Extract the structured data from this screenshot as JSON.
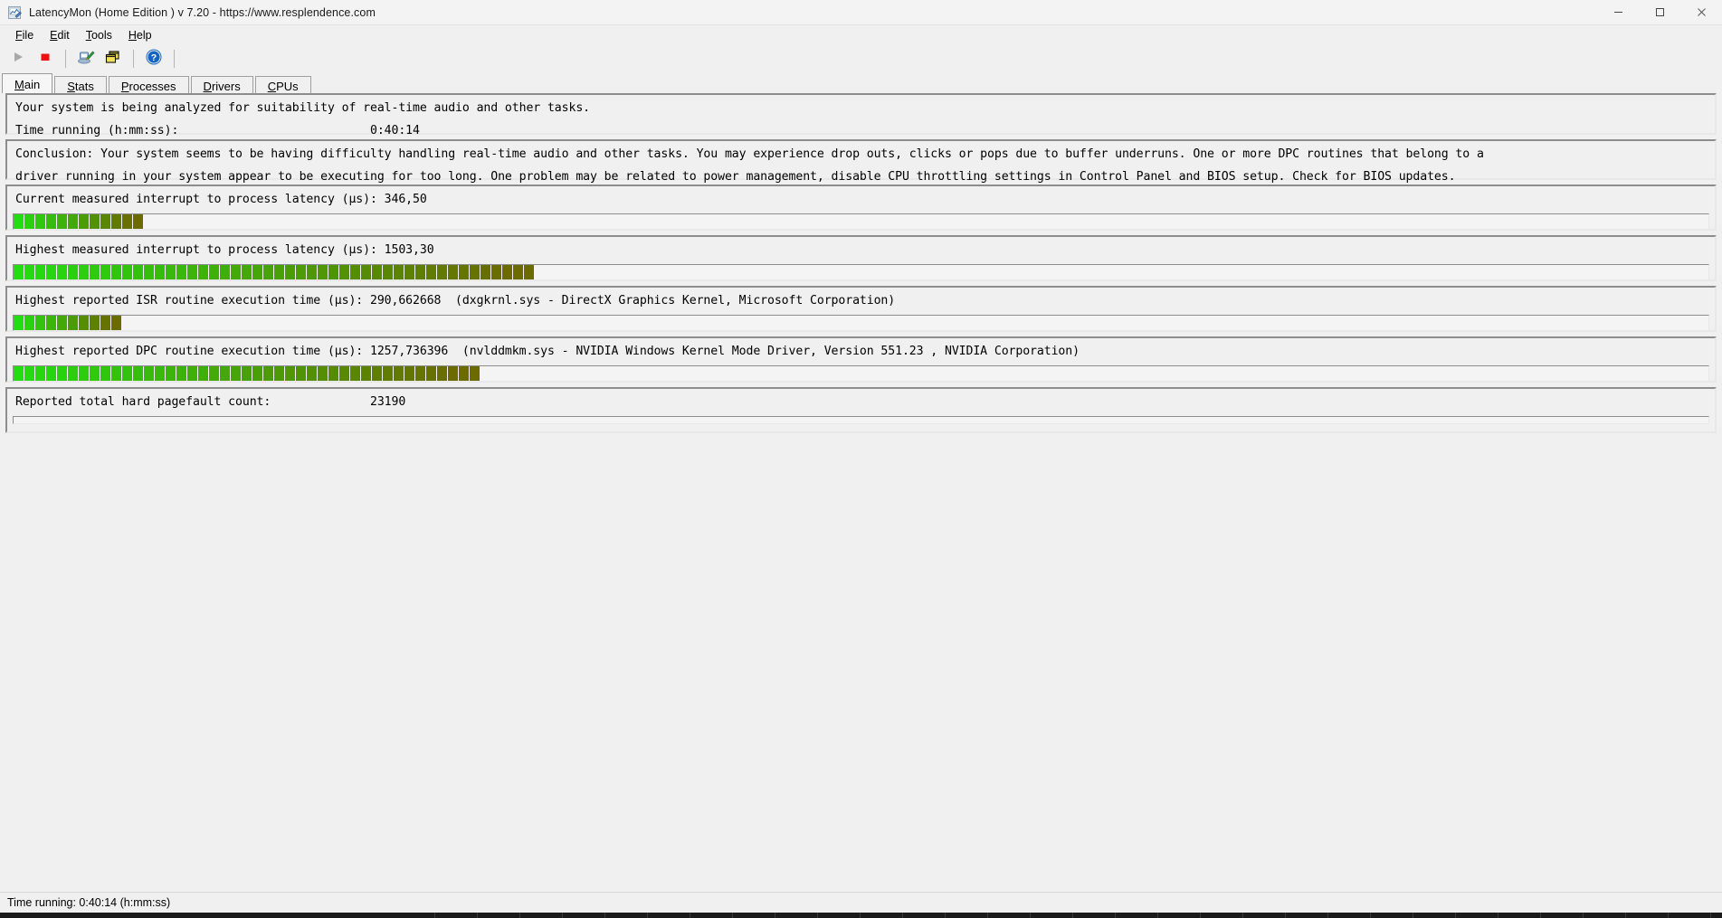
{
  "window": {
    "title": "LatencyMon  (Home Edition )  v 7.20 - https://www.resplendence.com",
    "app_icon": "latencymon-icon",
    "controls": {
      "minimize": "minimize-icon",
      "maximize": "maximize-icon",
      "close": "close-icon"
    }
  },
  "menubar": {
    "items": [
      {
        "label": "File",
        "mnemonic": "F"
      },
      {
        "label": "Edit",
        "mnemonic": "E"
      },
      {
        "label": "Tools",
        "mnemonic": "T"
      },
      {
        "label": "Help",
        "mnemonic": "H"
      }
    ]
  },
  "toolbar": {
    "buttons": [
      {
        "name": "start-button",
        "icon": "play-icon",
        "enabled": false
      },
      {
        "name": "stop-button",
        "icon": "stop-icon",
        "enabled": true
      },
      {
        "name": "system-info-button",
        "icon": "computer-pen-icon",
        "enabled": true
      },
      {
        "name": "windows-button",
        "icon": "cascade-windows-icon",
        "enabled": true
      },
      {
        "name": "help-button",
        "icon": "question-mark-icon",
        "enabled": true
      }
    ]
  },
  "tabs": {
    "active": "Main",
    "items": [
      {
        "label": "Main",
        "mnemonic": "M"
      },
      {
        "label": "Stats",
        "mnemonic": "S"
      },
      {
        "label": "Processes",
        "mnemonic": "P"
      },
      {
        "label": "Drivers",
        "mnemonic": "D"
      },
      {
        "label": "CPUs",
        "mnemonic": "C"
      }
    ]
  },
  "main": {
    "intro": {
      "line1": "Your system is being analyzed for suitability of real-time audio and other tasks.",
      "line2_label": "Time running (h:mm:ss):",
      "line2_value": "0:40:14"
    },
    "conclusion": {
      "line1": "Conclusion: Your system seems to be having difficulty handling real-time audio and other tasks. You may experience drop outs, clicks or pops due to buffer underruns. One or more DPC routines that belong to a",
      "line2": "driver running in your system appear to be executing for too long. One problem may be related to power management, disable CPU throttling settings in Control Panel and BIOS setup. Check for BIOS updates."
    },
    "metrics": [
      {
        "name": "current-interrupt-to-process-latency",
        "label": "Current measured interrupt to process latency (µs):",
        "value": "346,50",
        "detail": "",
        "bar_segments": 12,
        "bar_type": "segmented"
      },
      {
        "name": "highest-interrupt-to-process-latency",
        "label": "Highest measured interrupt to process latency (µs):",
        "value": "1503,30",
        "detail": "",
        "bar_segments": 48,
        "bar_type": "segmented"
      },
      {
        "name": "highest-isr-routine-execution-time",
        "label": "Highest reported ISR routine execution time (µs):",
        "value": "290,662668",
        "detail": "(dxgkrnl.sys - DirectX Graphics Kernel, Microsoft Corporation)",
        "bar_segments": 10,
        "bar_type": "segmented"
      },
      {
        "name": "highest-dpc-routine-execution-time",
        "label": "Highest reported DPC routine execution time (µs):",
        "value": "1257,736396",
        "detail": "(nvlddmkm.sys - NVIDIA Windows Kernel Mode Driver, Version 551.23 , NVIDIA Corporation)",
        "bar_segments": 43,
        "bar_type": "segmented"
      },
      {
        "name": "reported-total-hard-pagefault-count",
        "label": "Reported total hard pagefault count:",
        "value": "23190",
        "detail": "",
        "bar_segments": 0,
        "bar_type": "thin"
      }
    ]
  },
  "statusbar": {
    "text": "Time running: 0:40:14  (h:mm:ss)"
  },
  "colors": {
    "bar_green_start": "#22dd11",
    "bar_olive_end": "#6b6b00",
    "stop_red": "#ee1111",
    "help_blue": "#1565c0",
    "window_bg": "#f0f0f0"
  }
}
